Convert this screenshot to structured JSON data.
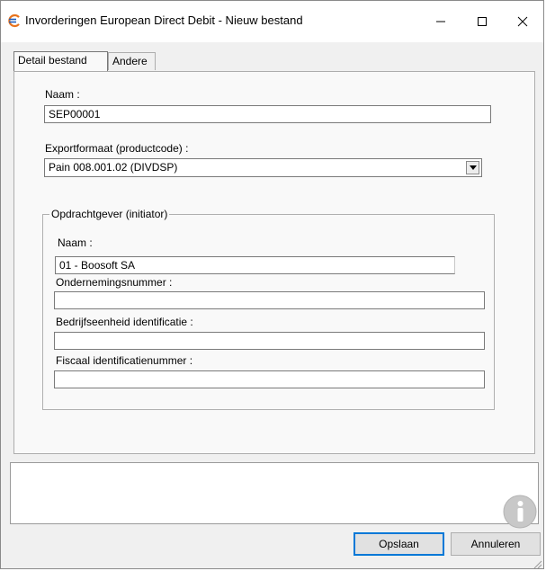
{
  "window": {
    "title": "Invorderingen European Direct Debit - Nieuw bestand"
  },
  "tabs": [
    {
      "label": "Detail bestand",
      "active": true
    },
    {
      "label": "Andere",
      "active": false
    }
  ],
  "form": {
    "name_label": "Naam :",
    "name_value": "SEP00001",
    "export_label": "Exportformaat (productcode) :",
    "export_value": "Pain 008.001.02 (DIVDSP)"
  },
  "initiator": {
    "legend": "Opdrachtgever (initiator)",
    "name_label": "Naam :",
    "name_value": "01 - Boosoft SA",
    "company_number_label": "Ondernemingsnummer :",
    "company_number_value": "",
    "business_unit_label": "Bedrijfseenheid identificatie :",
    "business_unit_value": "",
    "tax_id_label": "Fiscaal identificatienummer :",
    "tax_id_value": ""
  },
  "buttons": {
    "save": "Opslaan",
    "cancel": "Annuleren"
  },
  "icons": {
    "app": "euro-icon",
    "info": "info-icon"
  },
  "colors": {
    "app_icon_orange": "#e8731c",
    "app_icon_blue": "#1f5fbf",
    "default_button_border": "#0078d7",
    "info_icon_gray": "#c8c8c8"
  }
}
